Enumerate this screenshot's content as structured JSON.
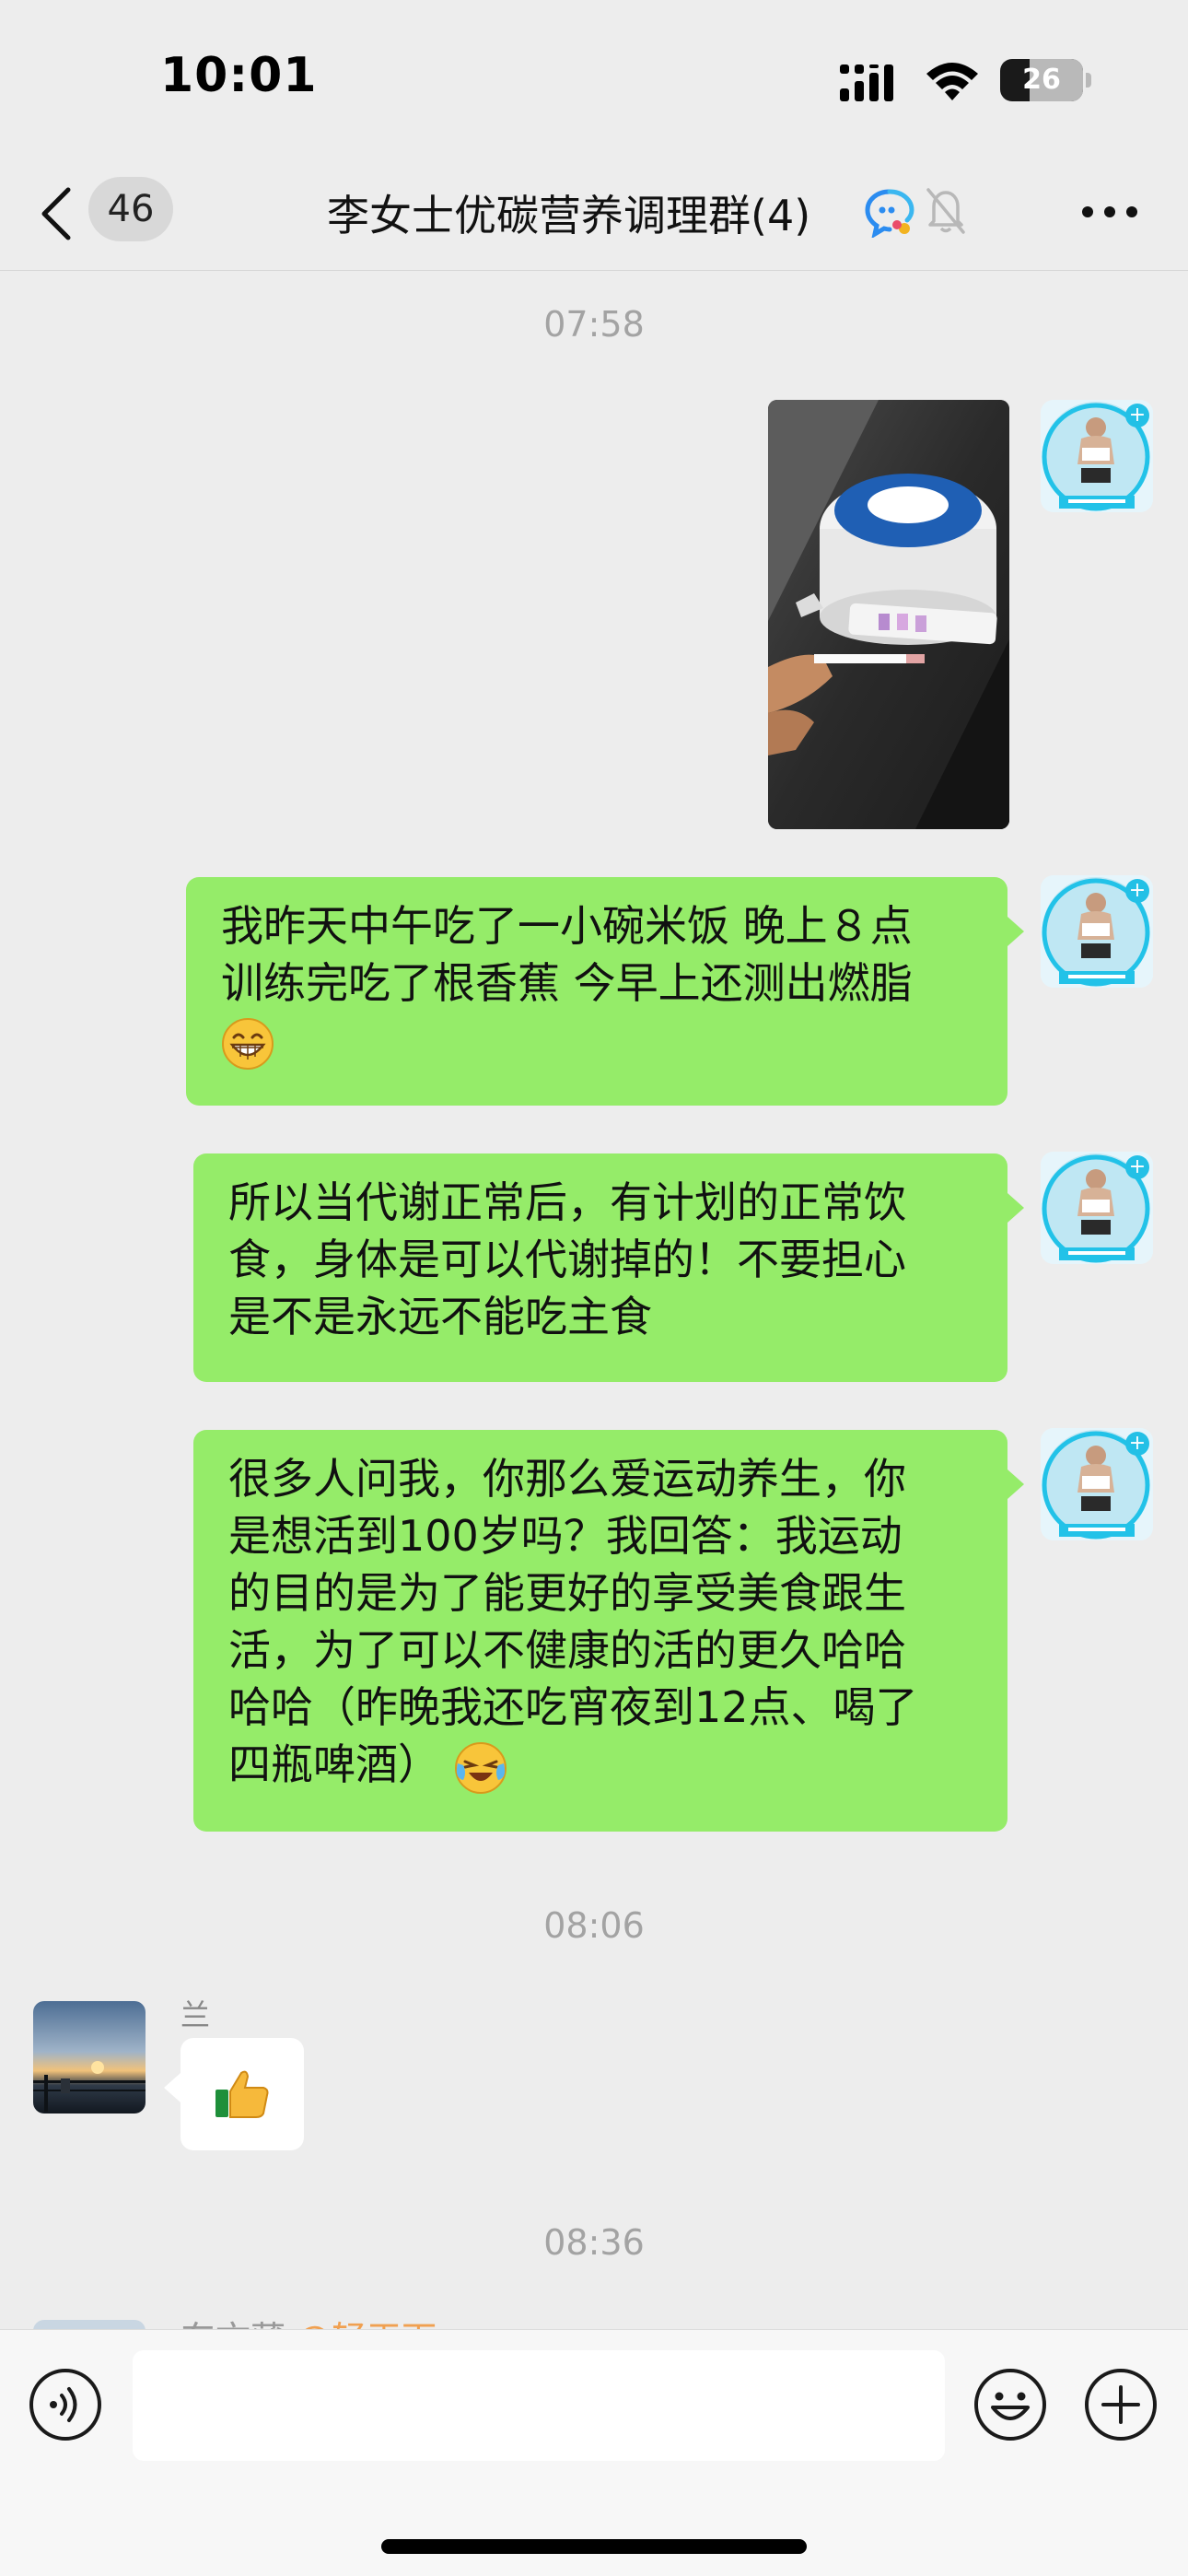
{
  "status_bar": {
    "time": "10:01",
    "battery": "26"
  },
  "nav": {
    "unread_count": "46",
    "title": "李女士优碳营养调理群(4)"
  },
  "messages": {
    "ts1": "07:58",
    "msg2_line1": "我昨天中午吃了一小碗米饭 晚上８点",
    "msg2_line2": "训练完吃了根香蕉 今早上还测出燃脂",
    "msg3_line1": "所以当代谢正常后，有计划的正常饮",
    "msg3_line2": "食，身体是可以代谢掉的！不要担心",
    "msg3_line3": "是不是永远不能吃主食",
    "msg4_line1": "很多人问我，你那么爱运动养生，你",
    "msg4_line2": "是想活到100岁吗？我回答：我运动",
    "msg4_line3": "的目的是为了能更好的享受美食跟生",
    "msg4_line4": "活，为了可以不健康的活的更久哈哈",
    "msg4_line5": "哈哈（昨晚我还吃宵夜到12点、喝了",
    "msg4_line6": "四瓶啤酒）",
    "ts2": "08:06",
    "sender_lan": "兰",
    "ts3": "08:36",
    "peek_sender": "东文薄",
    "peek_mention": "@轻天下"
  },
  "colors": {
    "bubble_self": "#95ec69",
    "background": "#ededed",
    "timestamp": "#a3a3a3"
  },
  "icons": {
    "back": "chevron-left-icon",
    "chat_badge": "group-chat-icon",
    "mute": "bell-off-icon",
    "more": "more-dots-icon",
    "voice": "voice-icon",
    "emoji": "smiley-icon",
    "plus": "plus-circle-icon"
  }
}
